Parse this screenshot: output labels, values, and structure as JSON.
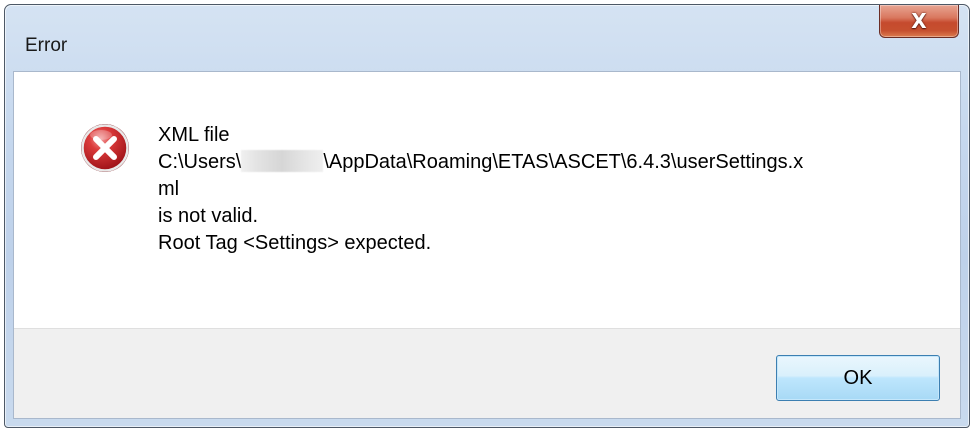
{
  "window": {
    "title": "Error",
    "close_glyph": "X"
  },
  "dialog": {
    "icon": "error-icon",
    "message_lines": {
      "line1": "XML file",
      "line2_prefix": "C:\\Users\\",
      "line2_suffix": "\\AppData\\Roaming\\ETAS\\ASCET\\6.4.3\\userSettings.x",
      "line3": "ml",
      "line4": "is not valid.",
      "line5": "Root Tag <Settings> expected."
    },
    "ok_label": "OK"
  },
  "colors": {
    "frame": "#c6d8ee",
    "close_button": "#c54a2e",
    "error_icon": "#c8262b",
    "ok_border": "#3c7fb1"
  }
}
